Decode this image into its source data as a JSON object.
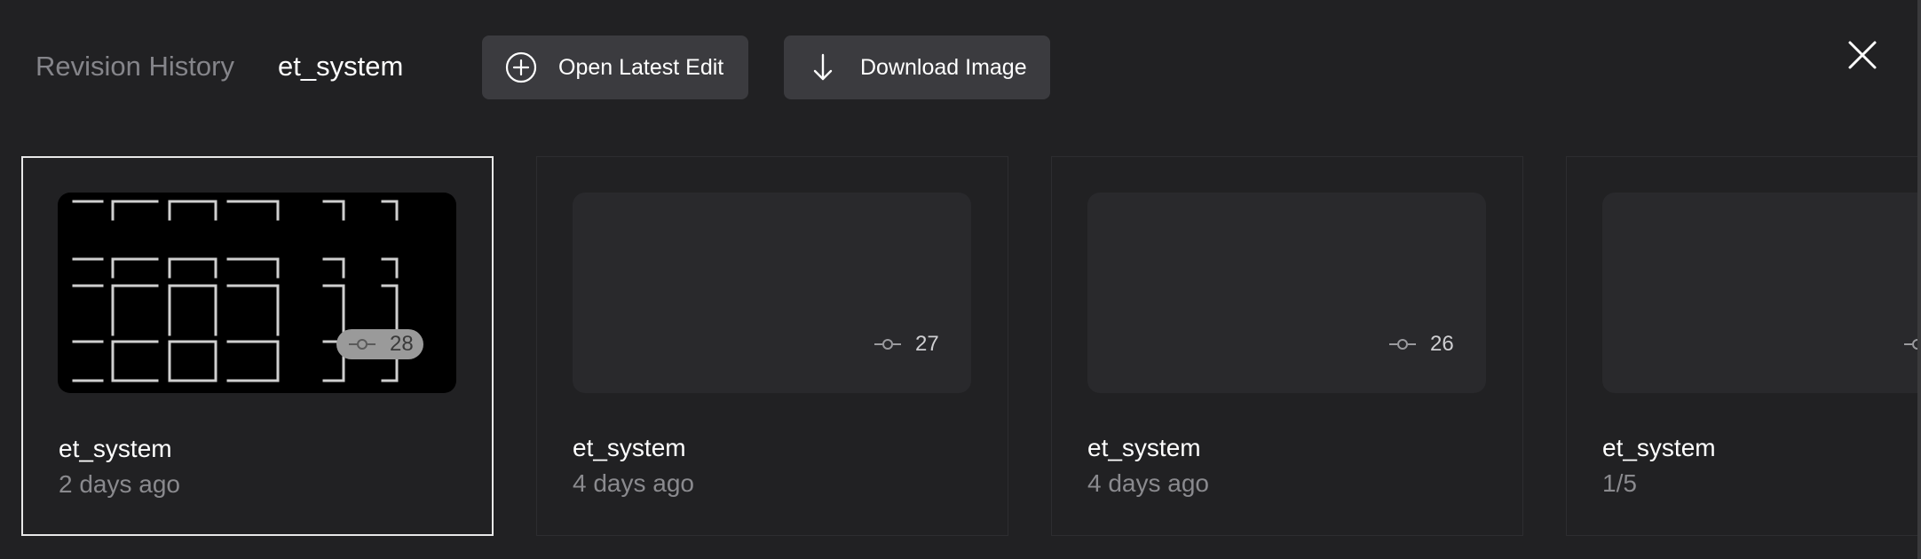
{
  "header": {
    "section_label": "Revision History",
    "file_name": "et_system",
    "open_latest_label": "Open Latest Edit",
    "download_label": "Download Image"
  },
  "revisions": [
    {
      "title": "et_system",
      "subtitle": "2 days ago",
      "revision": "28",
      "selected": true,
      "has_preview": true
    },
    {
      "title": "et_system",
      "subtitle": "4 days ago",
      "revision": "27",
      "selected": false,
      "has_preview": false
    },
    {
      "title": "et_system",
      "subtitle": "4 days ago",
      "revision": "26",
      "selected": false,
      "has_preview": false
    },
    {
      "title": "et_system",
      "subtitle": "1/5",
      "revision": "",
      "selected": false,
      "has_preview": false
    }
  ],
  "icons": {
    "open": "plus-circle-icon",
    "download": "arrow-down-icon",
    "close": "close-icon",
    "revision": "commit-icon"
  },
  "colors": {
    "background": "#212123",
    "button": "#3b3b3f",
    "muted_text": "#85858a",
    "selected_border": "#e8e8e8"
  }
}
